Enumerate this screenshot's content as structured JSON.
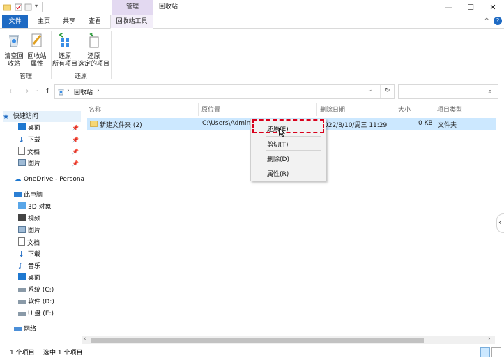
{
  "titlebar": {
    "context_tab": "管理",
    "window_title": "回收站",
    "minimize": "—",
    "maximize": "☐",
    "close": "✕"
  },
  "ribbon_tabs": {
    "file": "文件",
    "home": "主页",
    "share": "共享",
    "view": "查看",
    "recycle_tools": "回收站工具",
    "collapse": "^",
    "help": "?"
  },
  "ribbon": {
    "empty_bin": "清空回\n收站",
    "bin_props": "回收站\n属性",
    "group_manage": "管理",
    "restore_all": "还原\n所有项目",
    "restore_selected": "还原\n选定的项目",
    "group_restore": "还原"
  },
  "address": {
    "back": "←",
    "forward": "→",
    "recent": "⌄",
    "up": "↑",
    "sep1": "›",
    "location": "回收站",
    "sep2": "›",
    "dropdown": "⌄",
    "refresh": "↻",
    "search_icon": "⌕"
  },
  "nav": {
    "quick_access": "快速访问",
    "desktop": "桌面",
    "downloads": "下载",
    "documents": "文档",
    "pictures": "图片",
    "onedrive": "OneDrive - Persona",
    "this_pc": "此电脑",
    "objects3d": "3D 对象",
    "videos": "视频",
    "pictures2": "图片",
    "documents2": "文档",
    "downloads2": "下载",
    "music": "音乐",
    "desktop2": "桌面",
    "drive_c": "系统 (C:)",
    "drive_d": "软件 (D:)",
    "drive_e": "U 盘 (E:)",
    "network": "网络",
    "pin": "📌"
  },
  "columns": {
    "name": "名称",
    "original_location": "原位置",
    "date_deleted": "删除日期",
    "size": "大小",
    "item_type": "项目类型"
  },
  "row": {
    "name": "新建文件夹 (2)",
    "location": "C:\\Users\\Admini",
    "date": "022/8/10/周三 11:29",
    "size": "0 KB",
    "type": "文件夹"
  },
  "context_menu": {
    "restore": "还原(E)",
    "cut": "剪切(T)",
    "delete": "删除(D)",
    "properties": "属性(R)"
  },
  "status": {
    "count": "1 个项目",
    "selected": "选中 1 个项目"
  },
  "colors": {
    "accent": "#1e6ac3",
    "context_tab_bg": "#e3d9f1",
    "selected_row": "#cce8ff",
    "highlight_border": "#d9001b"
  }
}
